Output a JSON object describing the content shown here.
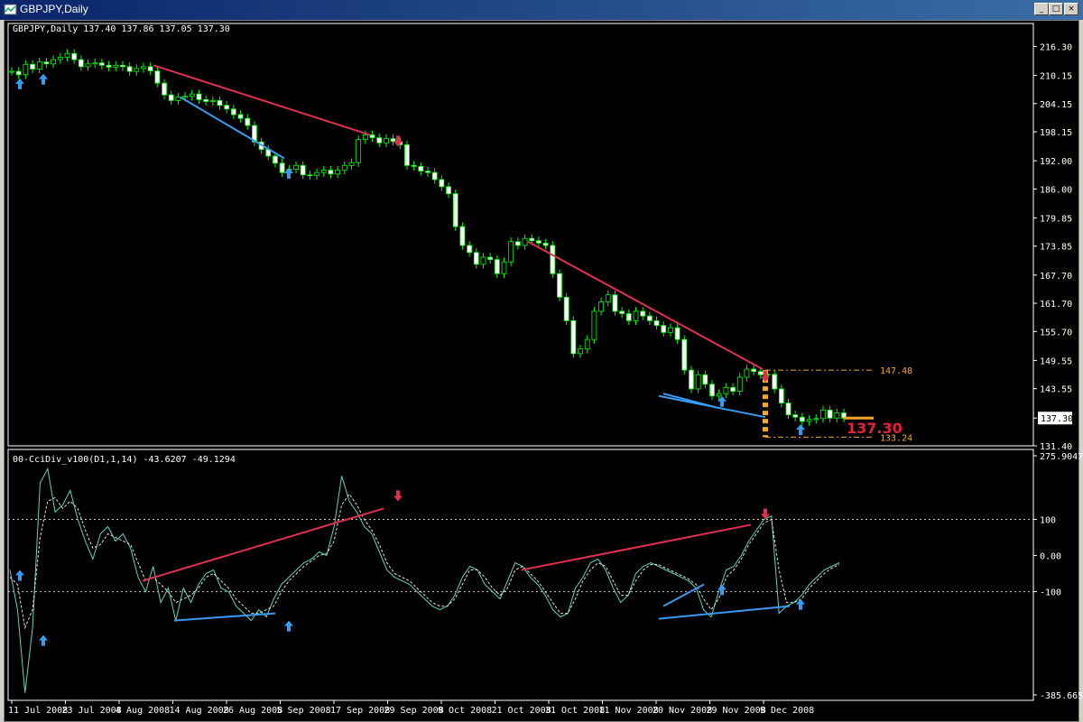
{
  "window": {
    "title": "GBPJPY,Daily",
    "buttons": [
      "_",
      "□",
      "×"
    ]
  },
  "main_header": "GBPJPY,Daily  137.40 137.86 137.05 137.30",
  "indicator_header": "00-CciDiv_v100(D1,1,14) -43.6207 -49.1294",
  "chart_data": [
    {
      "type": "candlestick",
      "title": "GBPJPY,Daily",
      "ohlc_last": {
        "open": 137.4,
        "high": 137.86,
        "low": 137.05,
        "close": 137.3
      },
      "ylim": [
        131.4,
        218.5
      ],
      "y_ticks": [
        "216.30",
        "210.15",
        "204.15",
        "198.15",
        "192.00",
        "186.00",
        "179.85",
        "173.85",
        "167.70",
        "161.70",
        "155.70",
        "149.55",
        "143.55",
        "137.30",
        "131.40"
      ],
      "current_price": "137.30",
      "levels": [
        {
          "label": "147.48",
          "value": 147.48
        },
        {
          "label": "133.24",
          "value": 133.24
        }
      ],
      "closes": [
        211.0,
        210.3,
        212.5,
        211.5,
        213.0,
        212.6,
        213.5,
        214.0,
        214.8,
        213.5,
        212.0,
        212.6,
        212.8,
        212.3,
        211.9,
        212.3,
        212.0,
        211.0,
        211.6,
        212.0,
        211.1,
        208.5,
        206.0,
        204.8,
        205.5,
        205.7,
        206.2,
        205.0,
        204.6,
        204.8,
        203.8,
        203.0,
        201.8,
        201.0,
        199.5,
        196.0,
        194.4,
        193.0,
        191.5,
        189.5,
        190.2,
        191.0,
        189.0,
        188.9,
        189.5,
        190.0,
        189.2,
        190.0,
        191.0,
        191.6,
        196.5,
        197.5,
        196.9,
        195.8,
        196.7,
        196.1,
        195.4,
        191.0,
        190.8,
        189.8,
        189.5,
        188.0,
        186.5,
        185.0,
        178.0,
        174.0,
        172.5,
        170.0,
        171.5,
        171.0,
        168.0,
        170.5,
        174.8,
        174.0,
        175.5,
        175.0,
        174.5,
        174.0,
        168.0,
        163.0,
        158.0,
        151.0,
        152.0,
        154.0,
        160.0,
        162.0,
        163.5,
        160.0,
        159.5,
        158.0,
        160.0,
        159.0,
        158.0,
        157.0,
        155.5,
        156.5,
        154.0,
        147.5,
        143.5,
        146.5,
        144.5,
        142.0,
        142.5,
        143.8,
        143.0,
        146.0,
        147.7,
        147.2,
        146.5,
        146.6,
        143.5,
        140.5,
        138.0,
        137.5,
        136.6,
        137.0,
        137.2,
        139.0,
        137.3,
        138.4,
        137.3
      ],
      "x_ticks": [
        "11 Jul 2008",
        "23 Jul 2008",
        "4 Aug 2008",
        "14 Aug 2008",
        "26 Aug 2008",
        "5 Sep 2008",
        "17 Sep 2008",
        "29 Sep 2008",
        "9 Oct 2008",
        "21 Oct 2008",
        "31 Oct 2008",
        "11 Nov 2008",
        "20 Nov 2008",
        "29 Nov 2008",
        "9 Dec 2008"
      ]
    },
    {
      "type": "line",
      "title": "00-CciDiv_v100(D1,1,14)",
      "series": [
        {
          "values": [
            -40.0,
            -150.0,
            -380.0,
            -200.0,
            200.0,
            240.0,
            120.0,
            140.0,
            180.0,
            100.0,
            40.0,
            -10.0,
            60.0,
            80.0,
            40.0,
            60.0,
            20.0,
            -60.0,
            -100.0,
            -30.0,
            -130.0,
            -90.0,
            -180.0,
            -90.0,
            -130.0,
            -80.0,
            -50.0,
            -40.0,
            -90.0,
            -100.0,
            -140.0,
            -160.0,
            -180.0,
            -150.0,
            -170.0,
            -120.0,
            -80.0,
            -60.0,
            -40.0,
            -20.0,
            -10.0,
            10.0,
            0.0,
            80.0,
            220.0,
            150.0,
            120.0,
            80.0,
            60.0,
            10.0,
            -40.0,
            -60.0,
            -70.0,
            -80.0,
            -100.0,
            -120.0,
            -140.0,
            -150.0,
            -140.0,
            -110.0,
            -60.0,
            -30.0,
            -40.0,
            -80.0,
            -100.0,
            -120.0,
            -70.0,
            -20.0,
            -30.0,
            -60.0,
            -80.0,
            -110.0,
            -150.0,
            -170.0,
            -160.0,
            -90.0,
            -60.0,
            -20.0,
            -10.0,
            -40.0,
            -90.0,
            -130.0,
            -110.0,
            -50.0,
            -30.0,
            -20.0,
            -30.0,
            -40.0,
            -50.0,
            -60.0,
            -70.0,
            -90.0,
            -150.0,
            -170.0,
            -100.0,
            -40.0,
            -30.0,
            0.0,
            40.0,
            70.0,
            100.0,
            110.0,
            -160.0,
            -140.0,
            -130.0,
            -110.0,
            -80.0,
            -60.0,
            -40.0,
            -30.0,
            -20.0
          ]
        },
        {
          "values": [
            -60.0,
            -80.0,
            -200.0,
            -150.0,
            50.0,
            150.0,
            160.0,
            130.0,
            150.0,
            130.0,
            70.0,
            20.0,
            30.0,
            60.0,
            50.0,
            40.0,
            30.0,
            -20.0,
            -70.0,
            -60.0,
            -80.0,
            -100.0,
            -130.0,
            -120.0,
            -110.0,
            -90.0,
            -60.0,
            -50.0,
            -70.0,
            -90.0,
            -120.0,
            -140.0,
            -160.0,
            -160.0,
            -150.0,
            -140.0,
            -100.0,
            -70.0,
            -50.0,
            -30.0,
            -15.0,
            0.0,
            5.0,
            40.0,
            140.0,
            170.0,
            140.0,
            100.0,
            70.0,
            30.0,
            -20.0,
            -50.0,
            -60.0,
            -70.0,
            -90.0,
            -110.0,
            -130.0,
            -140.0,
            -140.0,
            -120.0,
            -80.0,
            -40.0,
            -40.0,
            -60.0,
            -90.0,
            -110.0,
            -90.0,
            -40.0,
            -30.0,
            -50.0,
            -70.0,
            -100.0,
            -130.0,
            -160.0,
            -160.0,
            -120.0,
            -70.0,
            -40.0,
            -20.0,
            -30.0,
            -70.0,
            -110.0,
            -110.0,
            -70.0,
            -40.0,
            -25.0,
            -25.0,
            -35.0,
            -45.0,
            -55.0,
            -65.0,
            -80.0,
            -120.0,
            -150.0,
            -120.0,
            -60.0,
            -40.0,
            -10.0,
            30.0,
            60.0,
            90.0,
            100.0,
            -40.0,
            -130.0,
            -130.0,
            -120.0,
            -90.0,
            -70.0,
            -50.0,
            -35.0,
            -25.0
          ]
        }
      ],
      "ylim": [
        -385.665,
        275.9047
      ],
      "y_ticks": [
        "275.9047",
        "100",
        "0.00",
        "-100",
        "-385.665"
      ],
      "levels": [
        100,
        -100
      ]
    }
  ]
}
